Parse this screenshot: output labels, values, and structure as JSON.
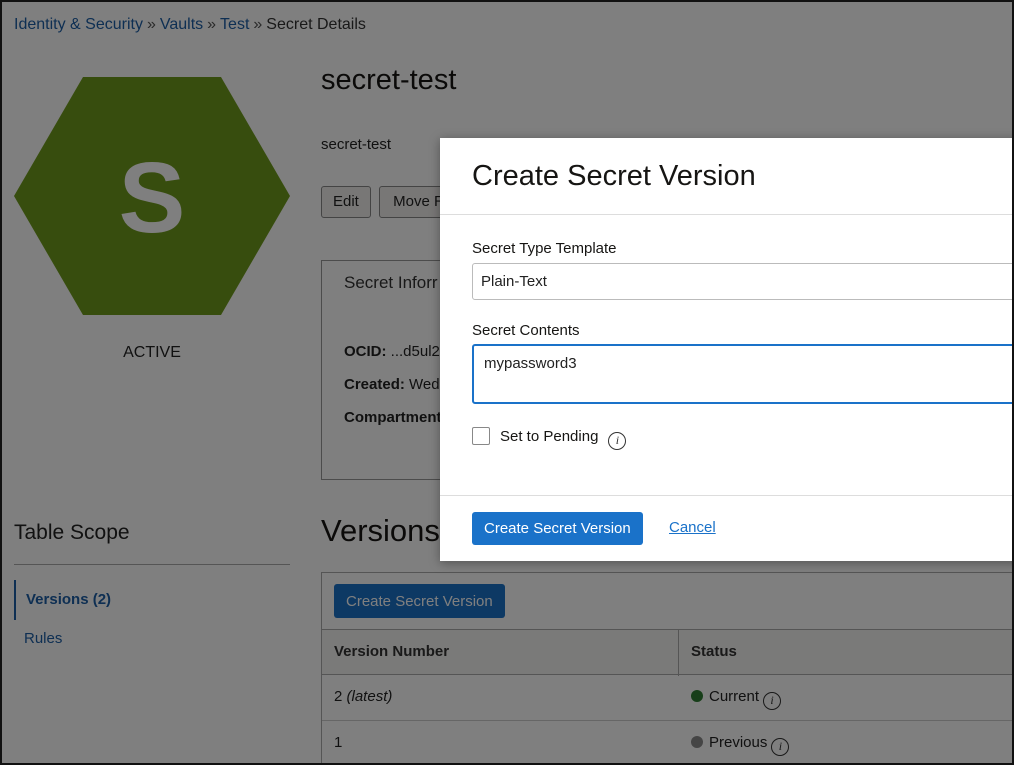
{
  "breadcrumb": {
    "items": [
      "Identity & Security",
      "Vaults",
      "Test"
    ],
    "current": "Secret Details",
    "separator": "»"
  },
  "secret": {
    "letter": "S",
    "status": "ACTIVE",
    "title": "secret-test",
    "description": "secret-test",
    "hex_color": "#6f9a1c"
  },
  "actions": {
    "edit": "Edit",
    "move": "Move R"
  },
  "info_card": {
    "title": "Secret Inforr",
    "ocid_label": "OCID:",
    "ocid_value": "...d5ul2",
    "created_label": "Created:",
    "created_value": "Wed",
    "compartment_label": "Compartment"
  },
  "table_scope": {
    "title": "Table Scope",
    "items": [
      "Versions (2)",
      "Rules"
    ]
  },
  "versions": {
    "title": "Versions",
    "create_button": "Create Secret Version",
    "columns": [
      "Version Number",
      "Status"
    ],
    "rows": [
      {
        "number": "2",
        "tag": "(latest)",
        "status": "Current",
        "dot_color": "#2e7d32"
      },
      {
        "number": "1",
        "tag": "",
        "status": "Previous",
        "dot_color": "#8a8a8a"
      }
    ]
  },
  "modal": {
    "title": "Create Secret Version",
    "template_label": "Secret Type Template",
    "template_value": "Plain-Text",
    "contents_label": "Secret Contents",
    "contents_value": "mypassword3",
    "pending_label": "Set to Pending",
    "submit": "Create Secret Version",
    "cancel": "Cancel"
  },
  "colors": {
    "accent": "#1a72c9",
    "link": "#1d5fa6"
  }
}
